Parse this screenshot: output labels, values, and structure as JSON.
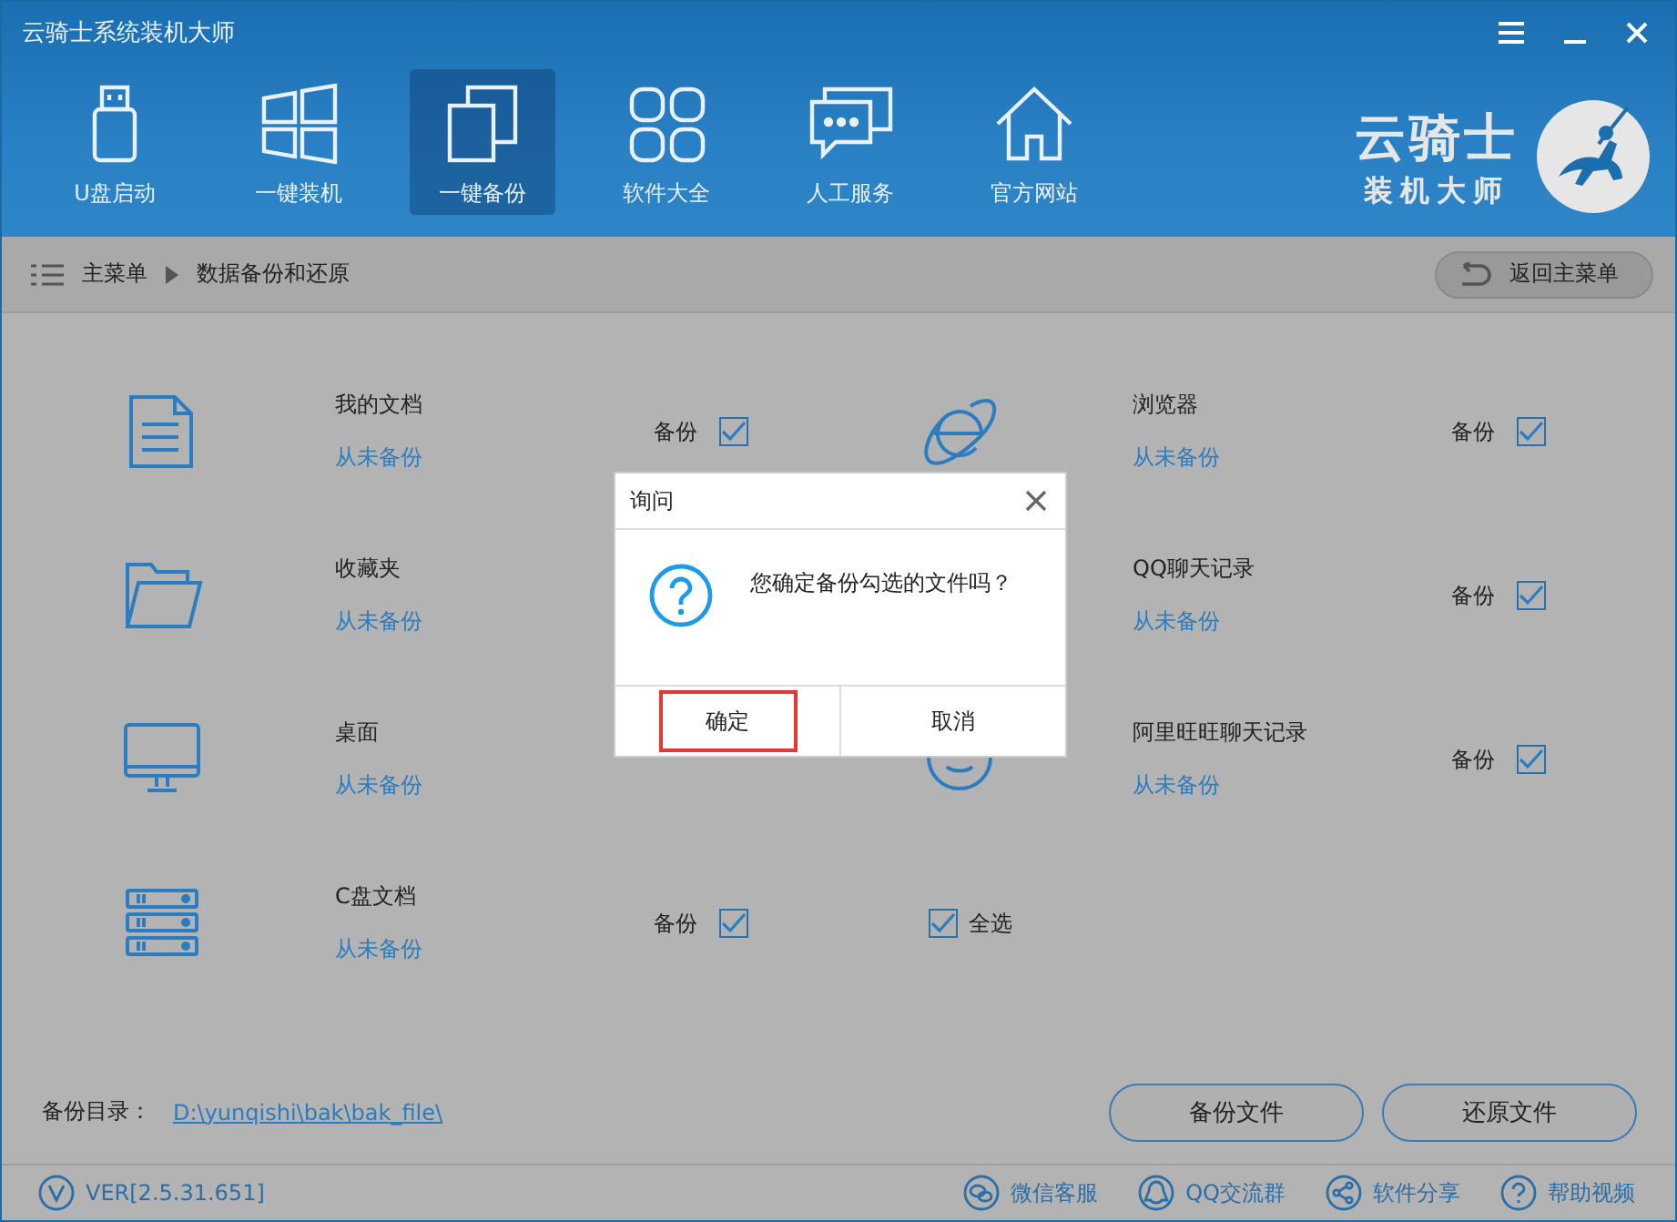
{
  "window": {
    "title": "云骑士系统装机大师"
  },
  "nav": [
    {
      "kind": "usb",
      "label": "U盘启动",
      "selected": false
    },
    {
      "kind": "windows",
      "label": "一键装机",
      "selected": false
    },
    {
      "kind": "copy",
      "label": "一键备份",
      "selected": true
    },
    {
      "kind": "apps",
      "label": "软件大全",
      "selected": false
    },
    {
      "kind": "chat",
      "label": "人工服务",
      "selected": false
    },
    {
      "kind": "home",
      "label": "官方网站",
      "selected": false
    }
  ],
  "logo": {
    "title": "云骑士",
    "subtitle": "装机大师"
  },
  "breadcrumb": {
    "items": [
      "主菜单",
      "数据备份和还原"
    ],
    "back_button": "返回主菜单"
  },
  "items": [
    {
      "kind": "document",
      "name": "我的文档",
      "status": "从未备份",
      "backup_label": "备份",
      "checked": true
    },
    {
      "kind": "browser",
      "name": "浏览器",
      "status": "从未备份",
      "backup_label": "备份",
      "checked": true
    },
    {
      "kind": "folder",
      "name": "收藏夹",
      "status": "从未备份"
    },
    {
      "kind": "qq",
      "name": "QQ聊天记录",
      "status": "从未备份",
      "backup_label": "备份",
      "checked": true
    },
    {
      "kind": "monitor",
      "name": "桌面",
      "status": "从未备份"
    },
    {
      "kind": "smile",
      "name": "阿里旺旺聊天记录",
      "status": "从未备份",
      "backup_label": "备份",
      "checked": true
    },
    {
      "kind": "server",
      "name": "C盘文档",
      "status": "从未备份",
      "backup_label": "备份",
      "checked": true
    }
  ],
  "select_all": {
    "label": "全选",
    "checked": true
  },
  "backup_dir": {
    "label": "备份目录：",
    "path": "D:\\yunqishi\\bak\\bak_file\\"
  },
  "actions": [
    "备份文件",
    "还原文件"
  ],
  "status_bar": {
    "version": "VER[2.5.31.651]",
    "links": [
      {
        "kind": "wechat",
        "label": "微信客服"
      },
      {
        "kind": "qq",
        "label": "QQ交流群"
      },
      {
        "kind": "share",
        "label": "软件分享"
      },
      {
        "kind": "help",
        "label": "帮助视频"
      }
    ]
  },
  "dialog": {
    "title": "询问",
    "message": "您确定备份勾选的文件吗？",
    "buttons": [
      {
        "label": "确定",
        "highlighted": true
      },
      {
        "label": "取消",
        "highlighted": false
      }
    ]
  }
}
